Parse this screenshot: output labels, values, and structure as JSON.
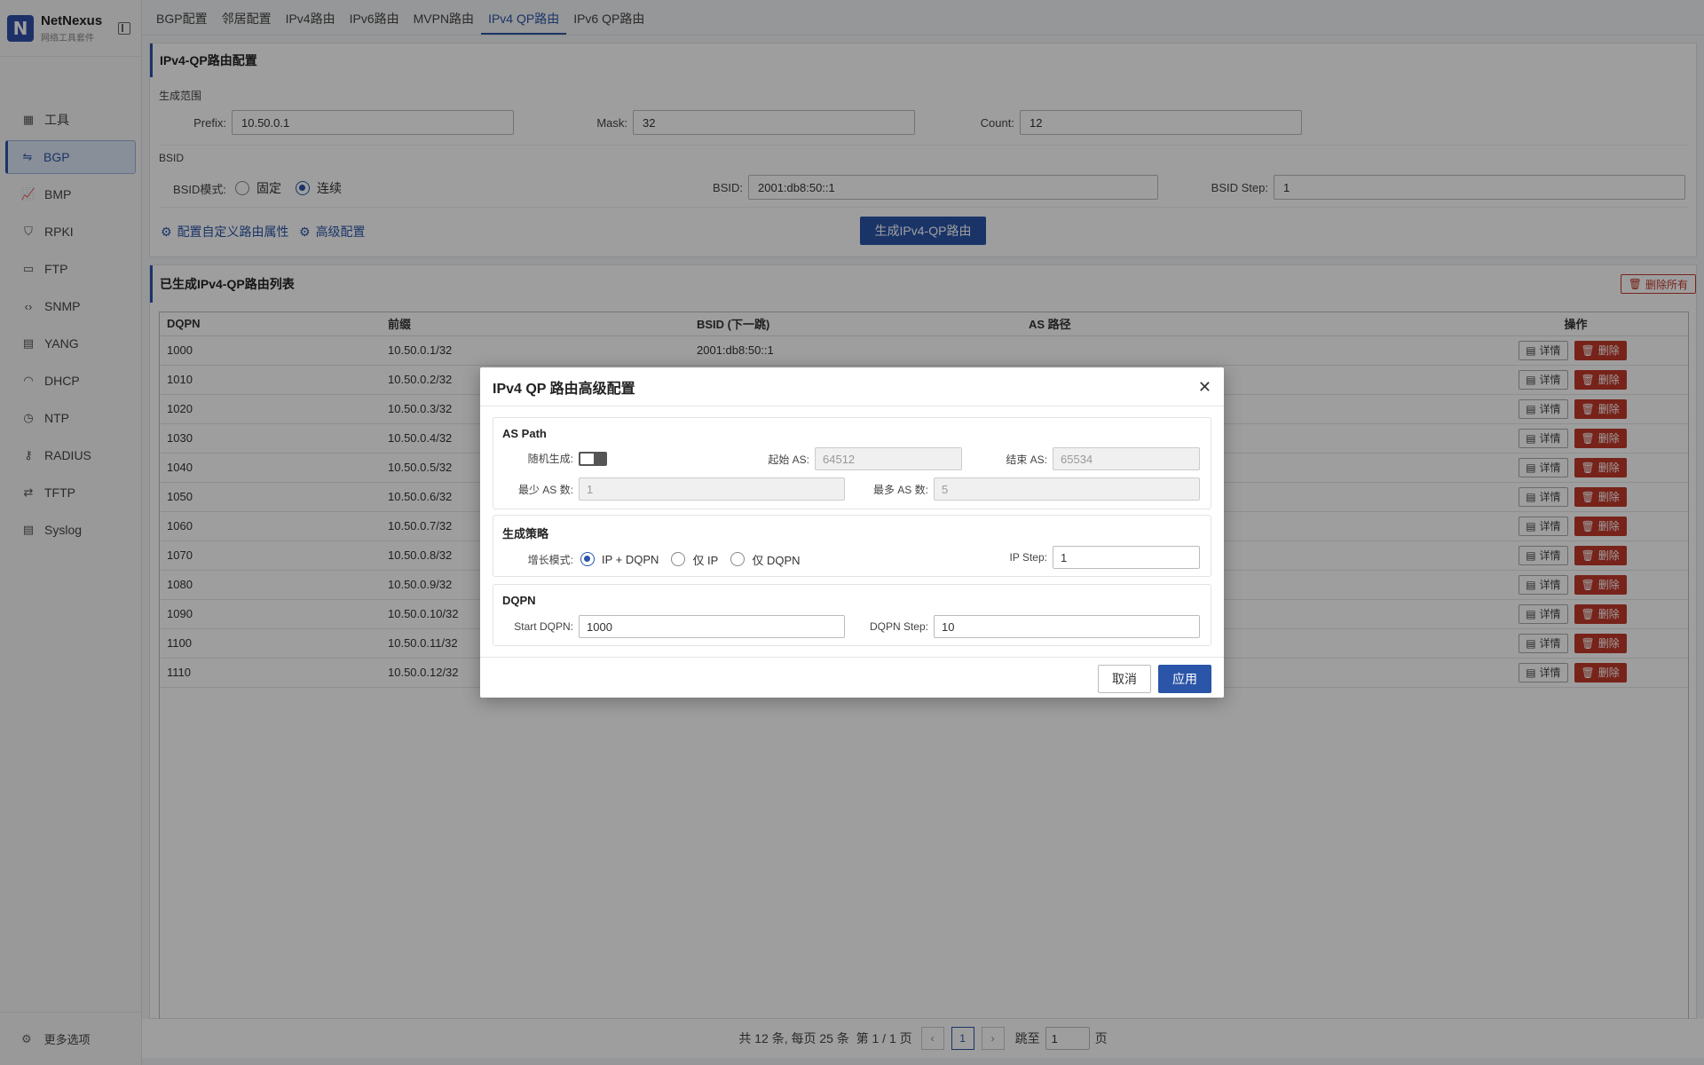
{
  "app": {
    "name": "NetNexus",
    "subtitle": "网络工具套件",
    "logo_letter": "N"
  },
  "sidebar": {
    "items": [
      {
        "label": "工具",
        "icon": "grid-icon"
      },
      {
        "label": "BGP",
        "icon": "share-icon",
        "active": true
      },
      {
        "label": "BMP",
        "icon": "chart-icon"
      },
      {
        "label": "RPKI",
        "icon": "shield-icon"
      },
      {
        "label": "FTP",
        "icon": "folder-icon"
      },
      {
        "label": "SNMP",
        "icon": "code-icon"
      },
      {
        "label": "YANG",
        "icon": "file-icon"
      },
      {
        "label": "DHCP",
        "icon": "wifi-icon"
      },
      {
        "label": "NTP",
        "icon": "clock-icon"
      },
      {
        "label": "RADIUS",
        "icon": "key-icon"
      },
      {
        "label": "TFTP",
        "icon": "transfer-icon"
      },
      {
        "label": "Syslog",
        "icon": "document-icon"
      }
    ],
    "more_label": "更多选项"
  },
  "tabs": [
    "BGP配置",
    "邻居配置",
    "IPv4路由",
    "IPv6路由",
    "MVPN路由",
    "IPv4 QP路由",
    "IPv6 QP路由"
  ],
  "active_tab": "IPv4 QP路由",
  "config": {
    "title": "IPv4-QP路由配置",
    "range_label": "生成范围",
    "prefix_label": "Prefix",
    "prefix_value": "10.50.0.1",
    "mask_label": "Mask",
    "mask_value": "32",
    "count_label": "Count",
    "count_value": "12",
    "bsid_section": "BSID",
    "bsid_mode_label": "BSID模式",
    "bsid_mode_fixed": "固定",
    "bsid_mode_cont": "连续",
    "bsid_label": "BSID",
    "bsid_value": "2001:db8:50::1",
    "bsid_step_label": "BSID Step",
    "bsid_step_value": "1",
    "custom_attr_link": "配置自定义路由属性",
    "advanced_link": "高级配置",
    "generate_button": "生成IPv4-QP路由"
  },
  "list": {
    "title": "已生成IPv4-QP路由列表",
    "delete_all": "删除所有",
    "columns": [
      "DQPN",
      "前缀",
      "BSID (下一跳)",
      "AS 路径",
      "操作"
    ],
    "detail_label": "详情",
    "delete_label": "删除",
    "rows": [
      {
        "dqpn": "1000",
        "prefix": "10.50.0.1/32",
        "bsid": "2001:db8:50::1",
        "as_path": ""
      },
      {
        "dqpn": "1010",
        "prefix": "10.50.0.2/32",
        "bsid": "",
        "as_path": ""
      },
      {
        "dqpn": "1020",
        "prefix": "10.50.0.3/32",
        "bsid": "",
        "as_path": ""
      },
      {
        "dqpn": "1030",
        "prefix": "10.50.0.4/32",
        "bsid": "",
        "as_path": ""
      },
      {
        "dqpn": "1040",
        "prefix": "10.50.0.5/32",
        "bsid": "",
        "as_path": ""
      },
      {
        "dqpn": "1050",
        "prefix": "10.50.0.6/32",
        "bsid": "",
        "as_path": ""
      },
      {
        "dqpn": "1060",
        "prefix": "10.50.0.7/32",
        "bsid": "",
        "as_path": ""
      },
      {
        "dqpn": "1070",
        "prefix": "10.50.0.8/32",
        "bsid": "",
        "as_path": ""
      },
      {
        "dqpn": "1080",
        "prefix": "10.50.0.9/32",
        "bsid": "",
        "as_path": ""
      },
      {
        "dqpn": "1090",
        "prefix": "10.50.0.10/32",
        "bsid": "",
        "as_path": ""
      },
      {
        "dqpn": "1100",
        "prefix": "10.50.0.11/32",
        "bsid": "",
        "as_path": ""
      },
      {
        "dqpn": "1110",
        "prefix": "10.50.0.12/32",
        "bsid": "",
        "as_path": ""
      }
    ]
  },
  "pager": {
    "summary": "共 12 条, 每页 25 条  第 1 / 1 页",
    "prev": "‹",
    "current": "1",
    "next": "›",
    "jump_label": "跳至",
    "jump_value": "1",
    "page_unit": "页"
  },
  "modal": {
    "title": "IPv4 QP 路由高级配置",
    "as_path": {
      "title": "AS Path",
      "random_label": "随机生成",
      "start_as_label": "起始 AS",
      "start_as_value": "64512",
      "end_as_label": "结束 AS",
      "end_as_value": "65534",
      "min_as_label": "最少 AS 数",
      "min_as_value": "1",
      "max_as_label": "最多 AS 数",
      "max_as_value": "5"
    },
    "strategy": {
      "title": "生成策略",
      "mode_label": "增长模式",
      "opt_ip_dqpn": "IP + DQPN",
      "opt_ip": "仅 IP",
      "opt_dqpn": "仅 DQPN",
      "ip_step_label": "IP Step",
      "ip_step_value": "1"
    },
    "dqpn": {
      "title": "DQPN",
      "start_label": "Start DQPN",
      "start_value": "1000",
      "step_label": "DQPN Step",
      "step_value": "10"
    },
    "cancel": "取消",
    "apply": "应用"
  }
}
